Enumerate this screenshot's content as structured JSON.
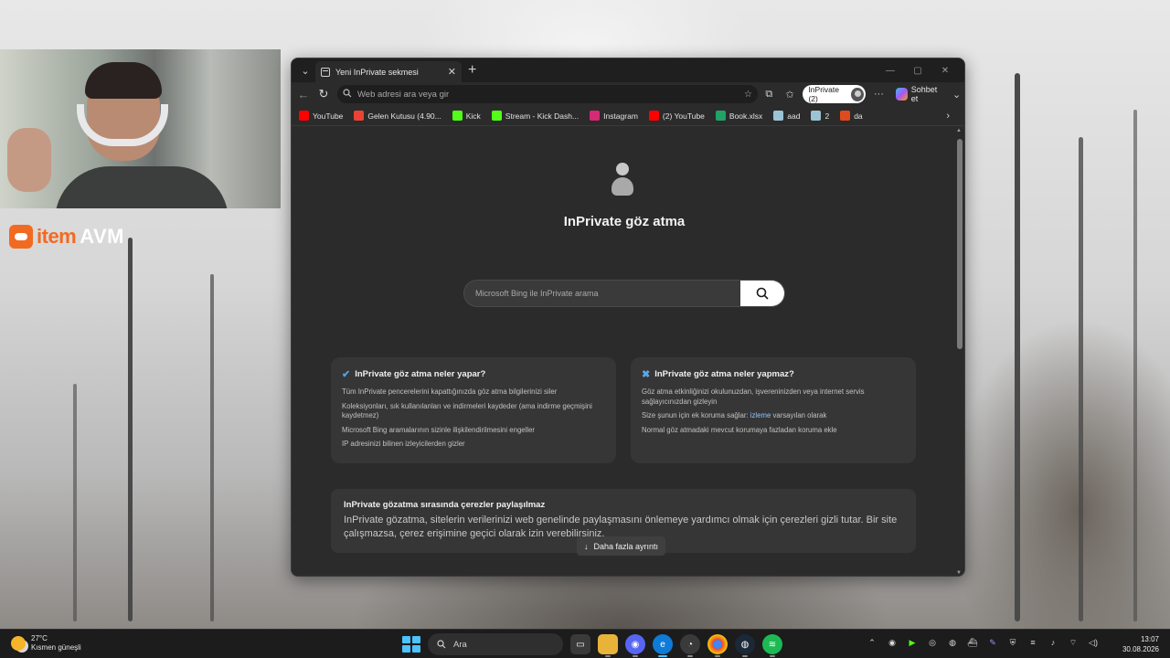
{
  "browser": {
    "tab_title": "Yeni InPrivate sekmesi",
    "address_placeholder": "Web adresi ara veya gir",
    "inprivate_label": "InPrivate (2)",
    "copilot_label": "Sohbet et",
    "bookmarks": [
      {
        "label": "YouTube",
        "color": "#ff0000"
      },
      {
        "label": "Gelen Kutusu (4.90...",
        "color": "#ea4335"
      },
      {
        "label": "Kick",
        "color": "#53fc18"
      },
      {
        "label": "Stream - Kick Dash...",
        "color": "#53fc18"
      },
      {
        "label": "Instagram",
        "color": "#d62976"
      },
      {
        "label": "(2) YouTube",
        "color": "#ff0000"
      },
      {
        "label": "Book.xlsx",
        "color": "#21a366"
      },
      {
        "label": "aad",
        "color": "#9cc3d5"
      },
      {
        "label": "2",
        "color": "#9cc3d5"
      },
      {
        "label": "da",
        "color": "#e04a1f"
      }
    ]
  },
  "page": {
    "title": "InPrivate göz atma",
    "search_placeholder": "Microsoft Bing ile InPrivate arama",
    "does_card": {
      "title": "InPrivate göz atma neler yapar?",
      "items": [
        "Tüm InPrivate pencerelerini kapattığınızda göz atma bilgilerinizi siler",
        "Koleksiyonları, sık kullanılanları ve indirmeleri kaydeder (ama indirme geçmişini kaydetmez)",
        "Microsoft Bing aramalarının sizinle ilişkilendirilmesini engeller",
        "IP adresinizi bilinen izleyicilerden gizler"
      ]
    },
    "doesnt_card": {
      "title": "InPrivate göz atma neler yapmaz?",
      "item1": "Göz atma etkinliğinizi okulunuzdan, işvereninizden veya internet servis sağlayıcınızdan gizleyin",
      "item2_prefix": "Size şunun için ek koruma sağlar:",
      "item2_link": "izleme",
      "item2_suffix": "varsayılan olarak",
      "item3": "Normal göz atmadaki mevcut korumaya fazladan koruma ekle"
    },
    "cookie": {
      "title": "InPrivate gözatma sırasında çerezler paylaşılmaz",
      "text": "InPrivate gözatma, sitelerin verilerinizi web genelinde paylaşmasını önlemeye yardımcı olmak için çerezleri gizli tutar. Bir site çalışmazsa, çerez erişimine geçici olarak izin verebilirsiniz."
    },
    "more_button": "Daha fazla ayrıntı"
  },
  "overlay": {
    "brand_item": "item",
    "brand_avm": "AVM"
  },
  "taskbar": {
    "temperature": "27°C",
    "weather_desc": "Kısmen güneşli",
    "search_label": "Ara",
    "time": "13:07",
    "date": "30.08.2026"
  }
}
